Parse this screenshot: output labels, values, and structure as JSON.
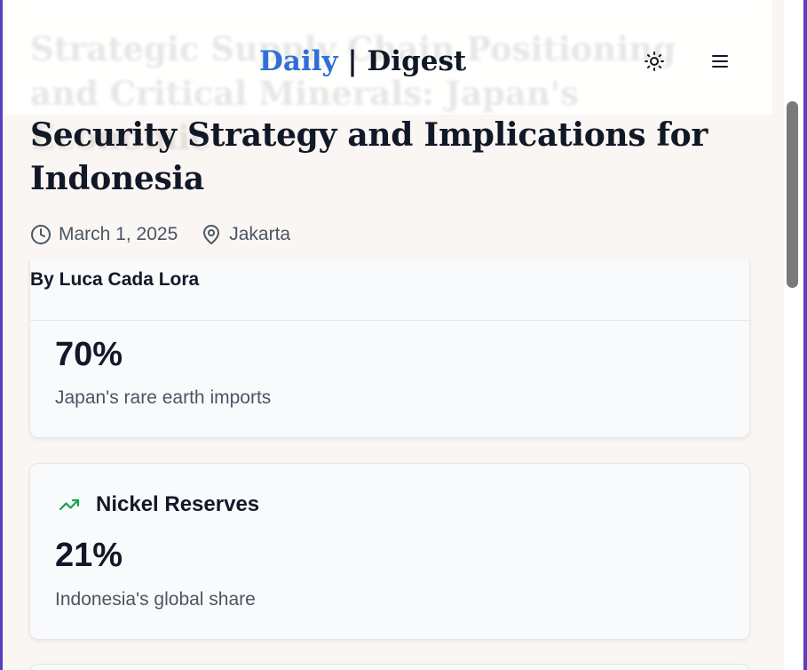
{
  "header": {
    "logo_part1": "Daily",
    "logo_separator": "|",
    "logo_part2": "Digest",
    "theme_toggle_icon": "sun-icon",
    "menu_icon": "hamburger-menu-icon"
  },
  "article": {
    "title_hidden_part": "Strategic Supply Chain Positioning and Critical Minerals: Japan's Economic",
    "title_visible_part": "Security Strategy and Implications for Indonesia",
    "date": "March 1, 2025",
    "location": "Jakarta",
    "byline": "By Luca Cada Lora"
  },
  "stats": [
    {
      "value": "70%",
      "label": "Japan's rare earth imports"
    },
    {
      "heading": "Nickel Reserves",
      "heading_icon": "trending-up-icon",
      "value": "21%",
      "label": "Indonesia's global share"
    }
  ],
  "colors": {
    "accent_blue": "#2f6fdb",
    "trend_green": "#16a34a",
    "page_background": "#faf6f3",
    "frame_border": "#5a3fc0"
  }
}
